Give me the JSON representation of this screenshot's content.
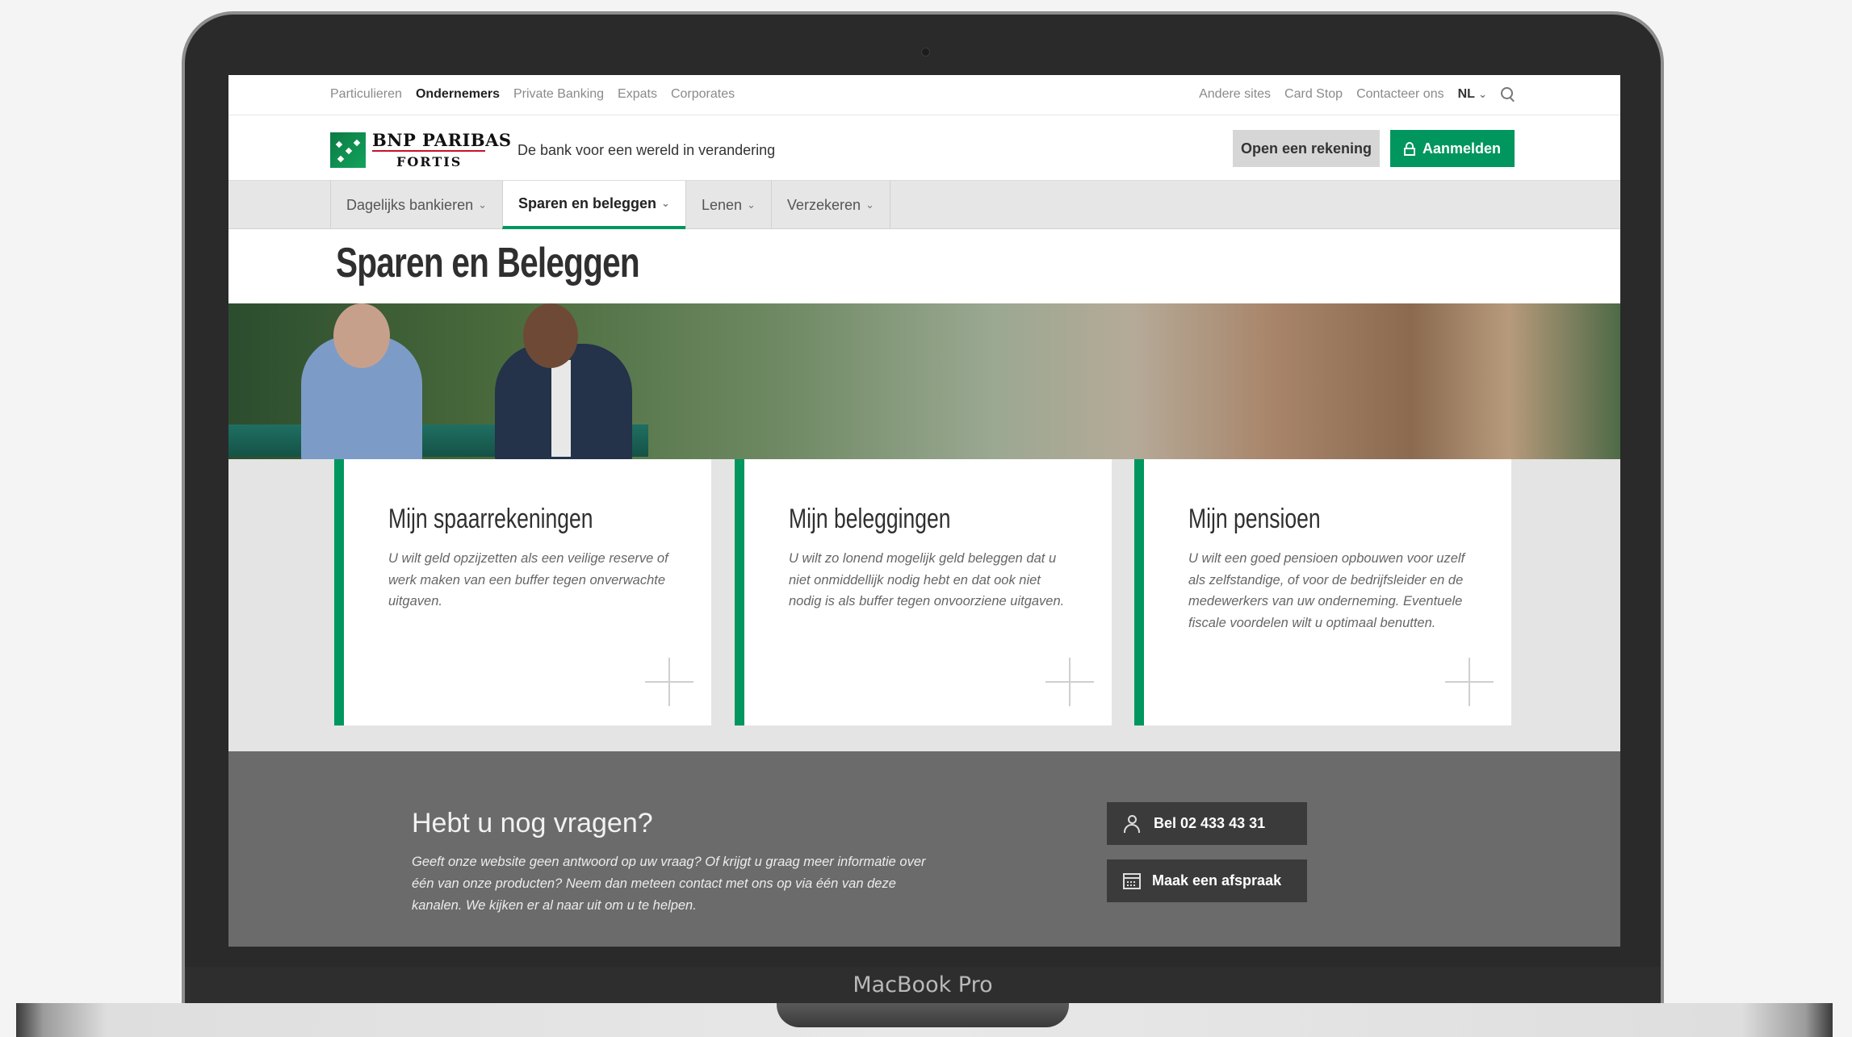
{
  "device": {
    "brand_label": "MacBook Pro"
  },
  "utility_nav": {
    "left": [
      "Particulieren",
      "Ondernemers",
      "Private Banking",
      "Expats",
      "Corporates"
    ],
    "active_index": 1,
    "right": [
      "Andere sites",
      "Card Stop",
      "Contacteer ons"
    ],
    "language": "NL"
  },
  "header": {
    "logo_line1": "BNP PARIBAS",
    "logo_line2": "FORTIS",
    "tagline": "De bank voor een wereld in verandering",
    "open_account_label": "Open een rekening",
    "login_label": "Aanmelden"
  },
  "main_nav": {
    "items": [
      "Dagelijks bankieren",
      "Sparen en beleggen",
      "Lenen",
      "Verzekeren"
    ],
    "active_index": 1
  },
  "page": {
    "title": "Sparen en Beleggen"
  },
  "cards": [
    {
      "title": "Mijn spaarrekeningen",
      "text": "U wilt geld opzijzetten als een veilige reserve of werk maken van een buffer tegen onverwachte uitgaven."
    },
    {
      "title": "Mijn beleggingen",
      "text": "U wilt zo lonend mogelijk geld beleggen dat u niet onmiddellijk nodig hebt en dat ook niet nodig is als buffer tegen onvoorziene uitgaven."
    },
    {
      "title": "Mijn pensioen",
      "text": "U wilt een goed pensioen opbouwen voor uzelf als zelfstandige, of voor de bedrijfsleider en de medewerkers van uw onderneming. Eventuele fiscale voordelen wilt u optimaal benutten."
    }
  ],
  "contact": {
    "title": "Hebt u nog vragen?",
    "text": "Geeft onze website geen antwoord op uw vraag? Of krijgt u graag meer informatie over één van onze producten? Neem dan meteen contact met ons op via één van deze kanalen. We kijken er al naar uit om u te helpen.",
    "call_label": "Bel 02 433 43 31",
    "appointment_label": "Maak een afspraak"
  },
  "colors": {
    "brand_green": "#00965e",
    "footer_gray": "#6b6b6b"
  }
}
